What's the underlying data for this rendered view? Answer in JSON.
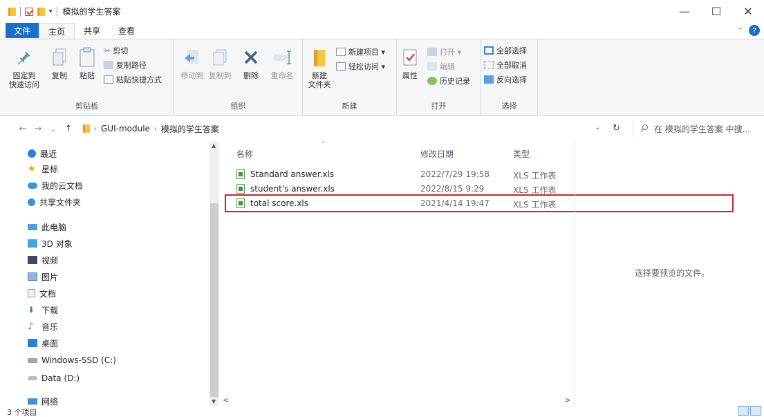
{
  "window": {
    "title": "模拟的学生答案",
    "qat_dropdown": "▾",
    "controls": {
      "minimize": "—",
      "maximize": "☐",
      "close": "✕"
    }
  },
  "ribbon_tabs": {
    "file": "文件",
    "home": "主页",
    "share": "共享",
    "view": "查看",
    "help": "?"
  },
  "ribbon": {
    "clipboard": {
      "pin_label_1": "固定到",
      "pin_label_2": "快速访问",
      "copy": "复制",
      "paste": "粘贴",
      "cut": "剪切",
      "copy_path": "复制路径",
      "paste_shortcut": "粘贴快捷方式",
      "group": "剪贴板"
    },
    "organize": {
      "move_to": "移动到",
      "copy_to": "复制到",
      "delete": "删除",
      "rename": "重命名",
      "group": "组织"
    },
    "new": {
      "new_folder_1": "新建",
      "new_folder_2": "文件夹",
      "new_item": "新建项目 ▾",
      "easy_access": "轻松访问 ▾",
      "group": "新建"
    },
    "open": {
      "properties": "属性",
      "open": "打开 ▾",
      "edit": "编辑",
      "history": "历史记录",
      "group": "打开"
    },
    "select": {
      "select_all": "全部选择",
      "select_none": "全部取消",
      "invert": "反向选择",
      "group": "选择"
    }
  },
  "address": {
    "back": "←",
    "forward": "→",
    "recent": "⌄",
    "up": "↑",
    "path": [
      "GUI-module",
      "模拟的学生答案"
    ],
    "separator": "›",
    "dropdown": "⌄",
    "refresh": "↻",
    "search_placeholder": "在 模拟的学生答案 中搜..."
  },
  "nav_items": [
    {
      "label": "最近",
      "icon": "clock-icon"
    },
    {
      "label": "星标",
      "icon": "star-icon"
    },
    {
      "label": "我的云文档",
      "icon": "cloud-icon"
    },
    {
      "label": "共享文件夹",
      "icon": "share-icon"
    },
    {
      "label": "此电脑",
      "icon": "computer-icon"
    },
    {
      "label": "3D 对象",
      "icon": "cube-icon"
    },
    {
      "label": "视频",
      "icon": "video-icon"
    },
    {
      "label": "图片",
      "icon": "picture-icon"
    },
    {
      "label": "文档",
      "icon": "document-icon"
    },
    {
      "label": "下载",
      "icon": "download-icon"
    },
    {
      "label": "音乐",
      "icon": "music-icon"
    },
    {
      "label": "桌面",
      "icon": "desktop-icon"
    },
    {
      "label": "Windows-SSD (C:)",
      "icon": "drive-icon"
    },
    {
      "label": "Data (D:)",
      "icon": "drive-icon"
    },
    {
      "label": "网络",
      "icon": "network-icon"
    }
  ],
  "columns": {
    "name": "名称",
    "date": "修改日期",
    "type": "类型"
  },
  "files": [
    {
      "name": "Standard answer.xls",
      "date": "2022/7/29 19:58",
      "type": "XLS 工作表"
    },
    {
      "name": "student's answer.xls",
      "date": "2022/8/15 9:29",
      "type": "XLS 工作表"
    },
    {
      "name": "total score.xls",
      "date": "2021/4/14 19:47",
      "type": "XLS 工作表"
    }
  ],
  "scroll": {
    "left": "<",
    "right": ">"
  },
  "preview_text": "选择要预览的文件。",
  "status": {
    "count": "3 个项目"
  },
  "colors": {
    "accent": "#1a6fc9",
    "highlight_border": "#c0282f",
    "folder": "#f4c542"
  }
}
